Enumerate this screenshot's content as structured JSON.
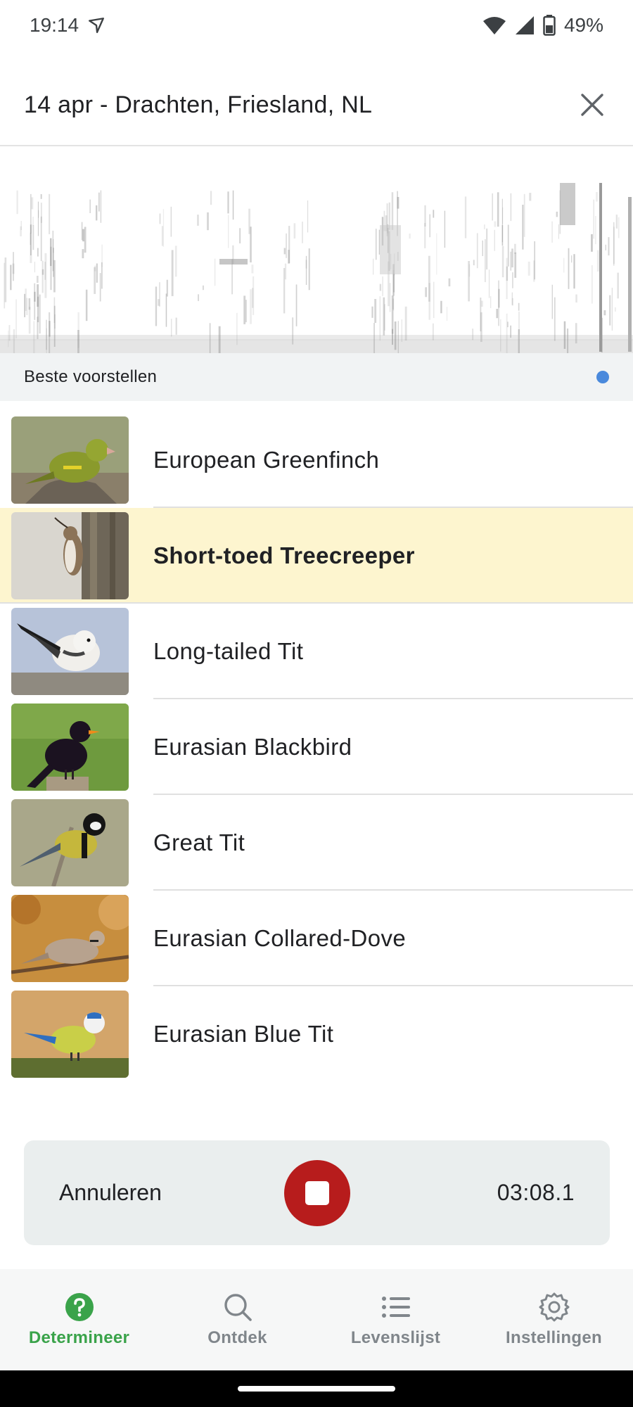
{
  "status_bar": {
    "time": "19:14",
    "battery": "49%"
  },
  "header": {
    "title": "14 apr - Drachten, Friesland, NL"
  },
  "section": {
    "title": "Beste voorstellen"
  },
  "species": [
    {
      "name": "European Greenfinch",
      "highlighted": false
    },
    {
      "name": "Short-toed Treecreeper",
      "highlighted": true
    },
    {
      "name": "Long-tailed Tit",
      "highlighted": false
    },
    {
      "name": "Eurasian Blackbird",
      "highlighted": false
    },
    {
      "name": "Great Tit",
      "highlighted": false
    },
    {
      "name": "Eurasian Collared-Dove",
      "highlighted": false
    },
    {
      "name": "Eurasian Blue Tit",
      "highlighted": false
    }
  ],
  "recorder": {
    "cancel_label": "Annuleren",
    "elapsed": "03:08.1"
  },
  "nav": [
    {
      "label": "Determineer",
      "icon": "help-circle-icon",
      "active": true
    },
    {
      "label": "Ontdek",
      "icon": "search-icon",
      "active": false
    },
    {
      "label": "Levenslijst",
      "icon": "list-icon",
      "active": false
    },
    {
      "label": "Instellingen",
      "icon": "gear-icon",
      "active": false
    }
  ],
  "colors": {
    "accent_green": "#3aa34a",
    "highlight_row": "#fdf5cf",
    "stop_red": "#b71c1c",
    "status_dot": "#4a89dc"
  }
}
